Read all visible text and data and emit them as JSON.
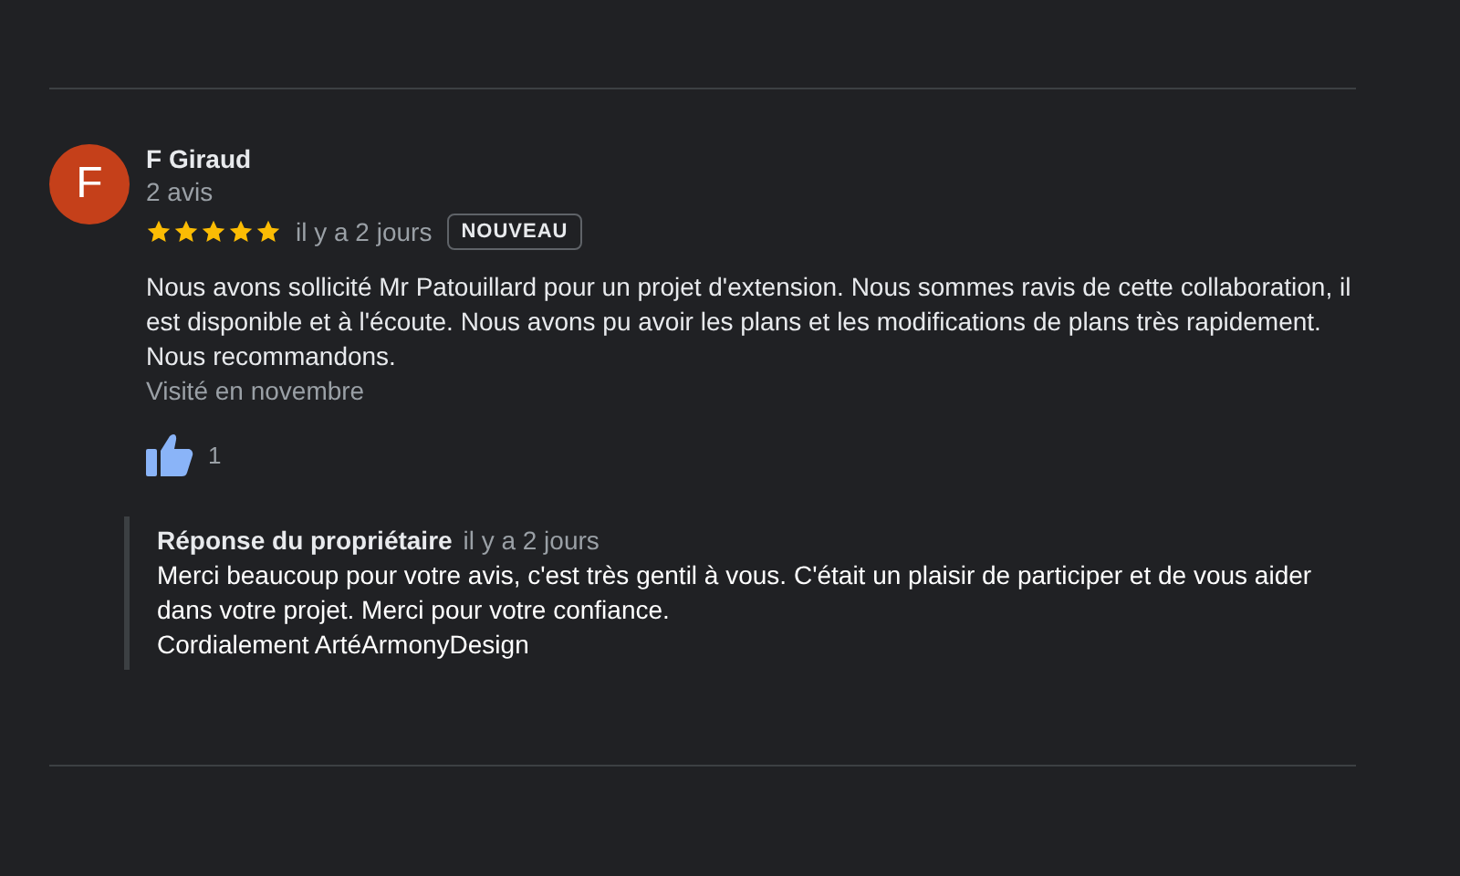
{
  "review": {
    "avatar_letter": "F",
    "author": "F Giraud",
    "review_count": "2 avis",
    "stars": 5,
    "date": "il y a 2 jours",
    "badge": "NOUVEAU",
    "paragraphs": [
      "Nous avons sollicité Mr Patouillard pour un projet d'extension. Nous sommes ravis de cette collaboration, il est disponible et à l'écoute. Nous avons pu avoir les plans et les modifications de plans très rapidement.",
      "Nous recommandons."
    ],
    "visited": "Visité en novembre",
    "likes": "1",
    "liked": true,
    "owner_reply": {
      "title": "Réponse du propriétaire",
      "date": "il y a 2 jours",
      "paragraphs": [
        "Merci beaucoup pour votre avis, c'est très gentil à vous. C'était un plaisir de participer et de vous aider dans votre projet. Merci pour votre confiance.",
        "Cordialement ArtéArmonyDesign"
      ]
    }
  }
}
